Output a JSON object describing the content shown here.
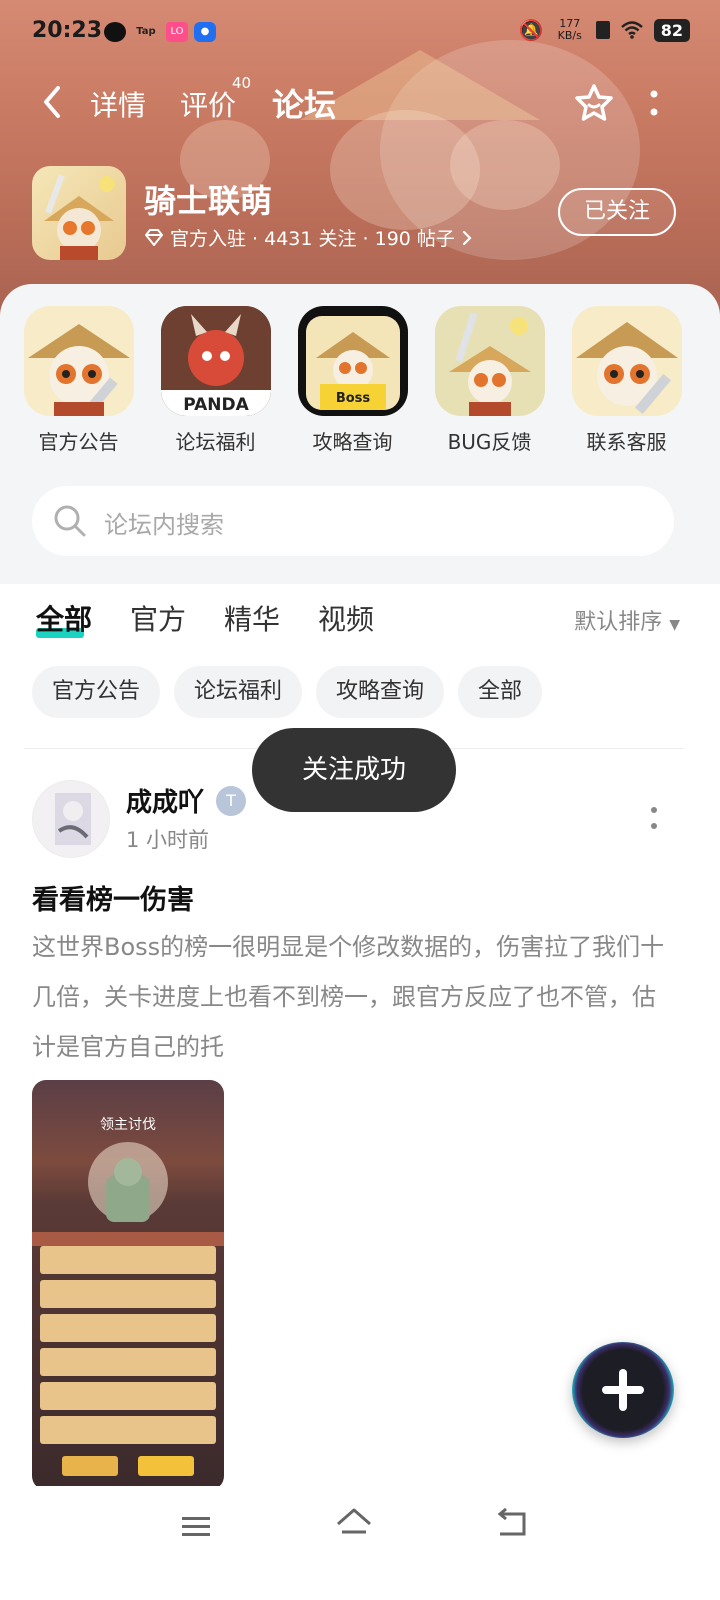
{
  "status_bar": {
    "time": "20:23",
    "network_speed": "177\nKB/s",
    "battery": "82"
  },
  "top_nav": {
    "tabs": [
      {
        "label": "详情"
      },
      {
        "label": "评价",
        "count": "40"
      },
      {
        "label": "论坛",
        "active": true
      }
    ]
  },
  "game": {
    "name": "骑士联萌",
    "meta": "官方入驻 · 4431 关注 · 190 帖子",
    "follow_label": "已关注"
  },
  "shortcuts": [
    {
      "label": "官方公告"
    },
    {
      "label": "论坛福利"
    },
    {
      "label": "攻略查询"
    },
    {
      "label": "BUG反馈"
    },
    {
      "label": "联系客服"
    }
  ],
  "search": {
    "placeholder": "论坛内搜索"
  },
  "filter_tabs": [
    {
      "label": "全部",
      "active": true
    },
    {
      "label": "官方"
    },
    {
      "label": "精华"
    },
    {
      "label": "视频"
    }
  ],
  "sort_label": "默认排序",
  "chips": [
    "官方公告",
    "论坛福利",
    "攻略查询",
    "全部"
  ],
  "toast": "关注成功",
  "post": {
    "author": "成成吖",
    "time": "1 小时前",
    "title": "看看榜一伤害",
    "body": "这世界Boss的榜一很明显是个修改数据的，伤害拉了我们十几倍，关卡进度上也看不到榜一，跟官方反应了也不管，估计是官方自己的托",
    "image_caption": "领主讨伐"
  },
  "colors": {
    "accent": "#1ad3c1",
    "banner": "#c97a63",
    "toast_bg": "#333333"
  }
}
